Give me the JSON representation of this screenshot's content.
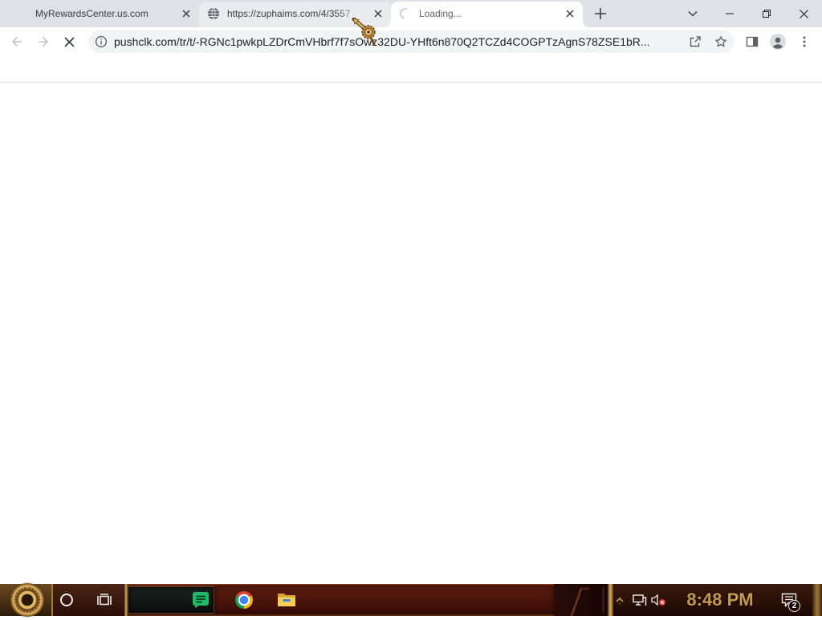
{
  "browser": {
    "tabs": [
      {
        "title": "MyRewardsCenter.us.com",
        "favicon": "",
        "active": false,
        "hovered": false
      },
      {
        "title": "https://zuphaims.com/4/3557",
        "favicon": "globe-icon",
        "active": false,
        "hovered": true
      },
      {
        "title": "Loading...",
        "favicon": "loading-spinner-icon",
        "active": true,
        "hovered": false
      }
    ],
    "tab_strip": {
      "new_tab_icon": "plus-icon",
      "tab_search_icon": "chevron-down-icon"
    },
    "window_controls": {
      "minimize_icon": "minimize-icon",
      "restore_icon": "restore-icon",
      "close_icon": "close-icon"
    },
    "toolbar": {
      "back": {
        "icon": "arrow-left-icon",
        "enabled": false
      },
      "forward": {
        "icon": "arrow-right-icon",
        "enabled": false
      },
      "stop": {
        "icon": "stop-icon",
        "page_loading": true
      },
      "omnibox": {
        "site_info_icon": "info-icon",
        "url": "pushclk.com/tr/t/-RGNc1pwkpLZDrCmVHbrf7f7sOwz32DU-YHft6n870Q2TCZd4COGPTzAgnS78ZSE1bR...",
        "share_icon": "share-icon",
        "bookmark_icon": "star-icon"
      },
      "side_panel_icon": "side-panel-icon",
      "profile_icon": "profile-avatar-icon",
      "menu_icon": "kebab-menu-icon"
    },
    "bookmarks_bar": {
      "items": []
    }
  },
  "taskbar": {
    "start_icon": "steampunk-gear-start-icon",
    "search_icon": "cortana-circle-icon",
    "task_view_icon": "task-view-icon",
    "pinned_apps": [
      {
        "icon": "green-app-icon"
      },
      {
        "icon": "chrome-icon"
      },
      {
        "icon": "file-explorer-icon"
      }
    ],
    "tray": {
      "overflow_icon": "chevron-up-icon",
      "network_icon": "network-icon",
      "volume_icon": "volume-muted-icon",
      "volume_muted": true,
      "clock": "8:48 PM",
      "notifications_icon": "action-center-icon",
      "notification_count": "2"
    }
  },
  "cursor": {
    "icon": "steampunk-pointer-icon"
  },
  "colors": {
    "tab_strip": "#dee1e6",
    "active_tab": "#ffffff",
    "hover_tab": "#e9ebee",
    "omnibox": "#f1f3f4",
    "taskbar_base": "#4a170d",
    "brass": "#c49a52",
    "clock_text": "#c49a52"
  }
}
